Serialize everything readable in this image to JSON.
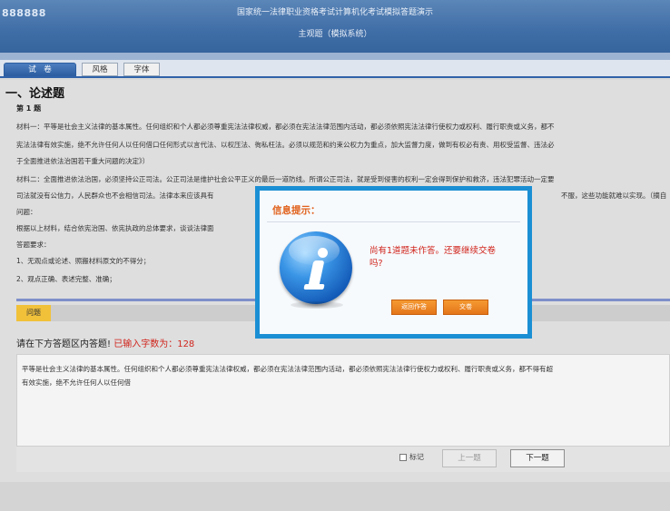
{
  "header": {
    "candidate_id": "888888",
    "title": "国家统一法律职业资格考试计算机化考试模拟答题演示",
    "subtitle": "主观题（模拟系统）"
  },
  "tabs": [
    {
      "label": "试　卷",
      "active": true
    },
    {
      "label": "风格",
      "active": false
    },
    {
      "label": "字体",
      "active": false
    }
  ],
  "question": {
    "section_title": "一、论述题",
    "number": "第 1 题",
    "lines": [
      "材料一：平等是社会主义法律的基本属性。任何组织和个人都必须尊重宪法法律权威，都必须在宪法法律范围内活动，都必须依照宪法法律行使权力或权利、履行职责或义务，都不",
      "宪法法律有效实施，绝不允许任何人以任何借口任何形式以言代法、以权压法、徇私枉法。必须以规范和约束公权力为重点，加大监督力度，做到有权必有责、用权受监督、违法必",
      "于全面推进依法治国若干重大问题的决定》）",
      "材料二：全面推进依法治国，必须坚持公正司法。公正司法是维护社会公平正义的最后一道防线。所谓公正司法，就是受到侵害的权利一定会得到保护和救济，违法犯罪活动一定要",
      "司法就没有公信力，人民群众也不会相信司法。法律本来应该具有",
      "问题：",
      "根据以上材料，结合依宪治国、依宪执政的总体要求，谈谈法律面",
      "答题要求：",
      "1、无观点或论述、照搬材料原文的不得分；",
      "2、观点正确、表述完整、准确；"
    ],
    "line2_tail": "不服，这些功能就难以实现。（摘自"
  },
  "answer": {
    "tag": "问题",
    "prompt": "请在下方答题区内答题!",
    "count_label": "已输入字数为：",
    "count": "128",
    "text_lines": [
      "平等是社会主义法律的基本属性。任何组织和个人都必须尊重宪法法律权威，都必须在宪法法律范围内活动，都必须依照宪法法律行使权力或权利、履行职责或义务，都不得有超",
      "有效实施，绝不允许任何人以任何借"
    ]
  },
  "footer": {
    "mark_label": "标记",
    "prev_label": "上一题",
    "next_label": "下一题"
  },
  "modal": {
    "title": "信息提示：",
    "message": "尚有1道题未作答。还要继续交卷吗?",
    "back_label": "返回作答",
    "submit_label": "交卷",
    "icon": "info-icon"
  }
}
